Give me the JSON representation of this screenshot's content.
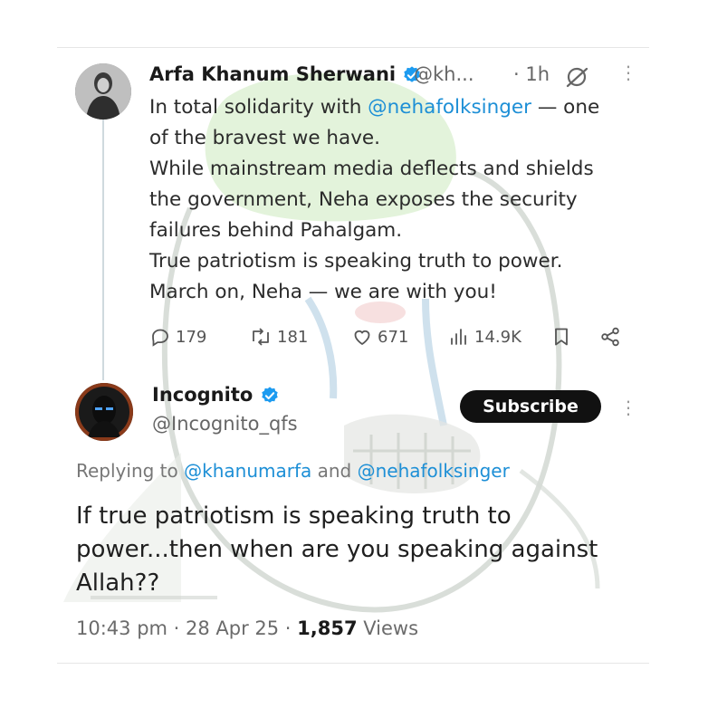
{
  "post1": {
    "name": "Arfa Khanum Sherwani",
    "handle": "@kh...",
    "time": "· 1h",
    "lines": [
      {
        "pre": "In total solidarity with ",
        "mention": "@nehafolksinger",
        "post": " — one"
      },
      {
        "text": "of the bravest we have."
      },
      {
        "text": "While mainstream media deflects and shields"
      },
      {
        "text": "the government, Neha exposes the security"
      },
      {
        "text": "failures behind Pahalgam."
      },
      {
        "text": "True patriotism is speaking truth to power."
      },
      {
        "text": "March on, Neha — we are with you!"
      }
    ],
    "actions": {
      "replies": "179",
      "reposts": "181",
      "likes": "671",
      "views": "14.9K"
    }
  },
  "post2": {
    "name": "Incognito",
    "handle": "@Incognito_qfs",
    "subscribe_label": "Subscribe",
    "replying_prefix": "Replying to ",
    "replying_mention1": "@khanumarfa",
    "replying_and": " and ",
    "replying_mention2": "@nehafolksinger",
    "lines": [
      "If true patriotism is speaking truth to",
      "power...then when are you speaking against",
      "Allah??"
    ],
    "time": "10:43 pm · 28 Apr 25 · ",
    "views_count": "1,857",
    "views_label": " Views"
  },
  "colors": {
    "link": "#1d8fd6",
    "verified": "#1d9bf0",
    "subscribe_bg": "#111111"
  }
}
